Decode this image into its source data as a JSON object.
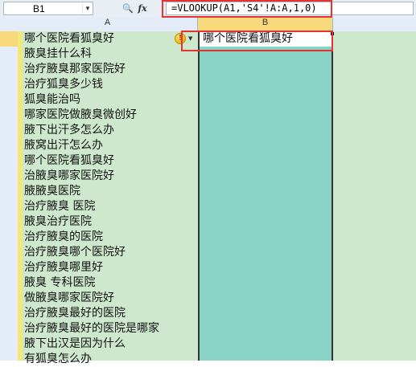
{
  "formula_bar": {
    "cell_ref": "B1",
    "formula": "=VLOOKUP(A1,'S4'!A:A,1,0)",
    "icons": [
      "zoom-icon",
      "fx-icon"
    ]
  },
  "columns": [
    "A",
    "B"
  ],
  "column_a": [
    "哪个医院看狐臭好",
    "腋臭挂什么科",
    "治疗腋臭那家医院好",
    "治疗狐臭多少钱",
    "狐臭能治吗",
    "哪家医院做腋臭微创好",
    "腋下出汗多怎么办",
    "腋窝出汗怎么办",
    "哪个医院看狐臭好",
    "治腋臭哪家医院好",
    "腋腋臭医院",
    "治疗腋臭 医院",
    "腋臭治疗医院",
    "治疗腋臭的医院",
    "治疗腋臭哪个医院好",
    "治疗腋臭哪里好",
    "腋臭 专科医院",
    "做腋臭哪家医院好",
    "治疗腋臭最好的医院",
    "治疗腋臭最好的医院是哪家",
    "腋下出汉是因为什么",
    "有狐臭怎么办"
  ],
  "column_b": {
    "b1_value": "哪个医院看狐臭好"
  },
  "colors": {
    "column_a_fill": "#cde8cd",
    "column_b_fill": "#88d3c3",
    "highlight_red": "#e53333",
    "selected_header": "#f7d87b"
  }
}
